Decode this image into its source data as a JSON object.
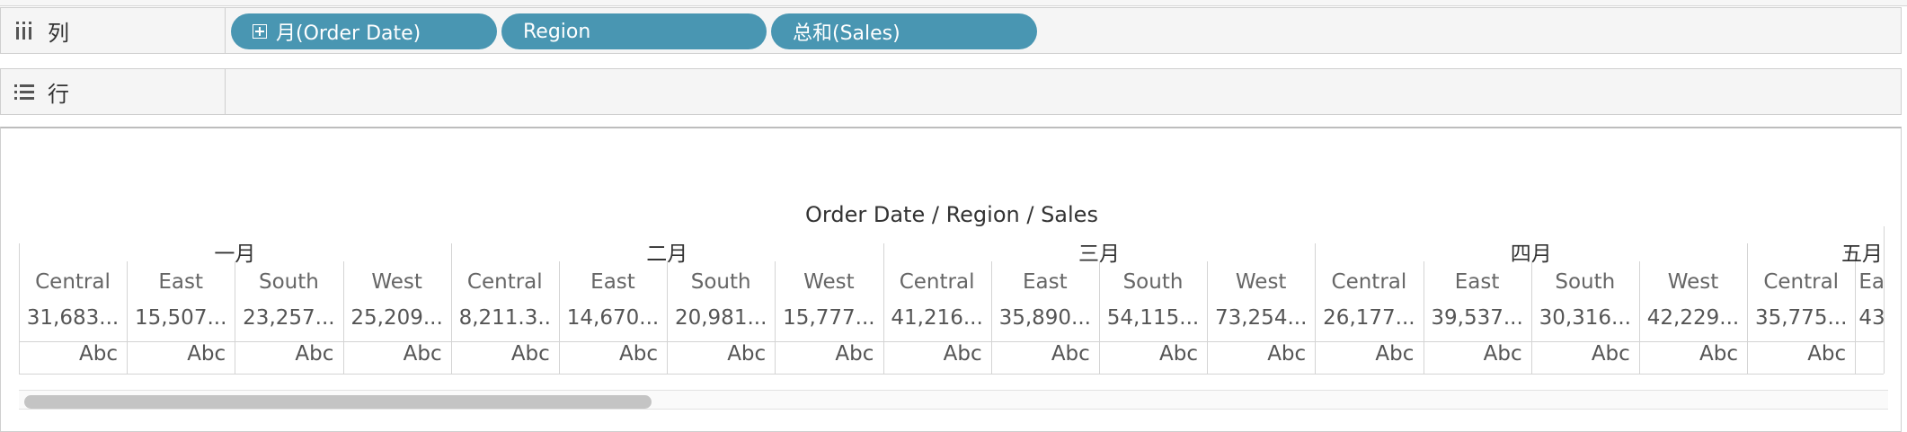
{
  "shelves": {
    "columns_label": "列",
    "rows_label": "行",
    "pills": [
      "月(Order Date)",
      "Region",
      "总和(Sales)"
    ]
  },
  "view": {
    "title": "Order Date / Region / Sales",
    "months": [
      "一月",
      "二月",
      "三月",
      "四月",
      "五月"
    ],
    "regions": [
      "Central",
      "East",
      "South",
      "West"
    ],
    "cells": [
      {
        "region": "Central",
        "value": "31,683..."
      },
      {
        "region": "East",
        "value": "15,507..."
      },
      {
        "region": "South",
        "value": "23,257..."
      },
      {
        "region": "West",
        "value": "25,209..."
      },
      {
        "region": "Central",
        "value": "8,211.3.."
      },
      {
        "region": "East",
        "value": "14,670..."
      },
      {
        "region": "South",
        "value": "20,981..."
      },
      {
        "region": "West",
        "value": "15,777..."
      },
      {
        "region": "Central",
        "value": "41,216..."
      },
      {
        "region": "East",
        "value": "35,890..."
      },
      {
        "region": "South",
        "value": "54,115..."
      },
      {
        "region": "West",
        "value": "73,254..."
      },
      {
        "region": "Central",
        "value": "26,177..."
      },
      {
        "region": "East",
        "value": "39,537..."
      },
      {
        "region": "South",
        "value": "30,316..."
      },
      {
        "region": "West",
        "value": "42,229..."
      },
      {
        "region": "Central",
        "value": "35,775..."
      },
      {
        "region": "Ea",
        "value": "43"
      }
    ],
    "mark_text": "Abc"
  }
}
